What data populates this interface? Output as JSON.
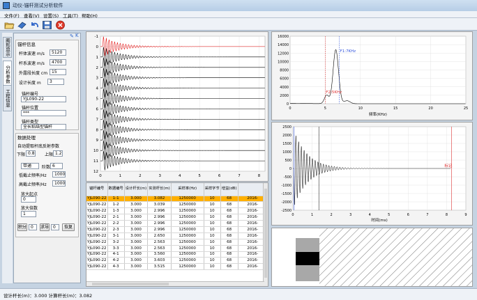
{
  "app": {
    "title": "动仪-锚杆测试分析软件"
  },
  "menu": [
    "文件(F)",
    "查看(V)",
    "设置(S)",
    "工具(T)",
    "帮助(H)"
  ],
  "toolbar": {
    "icons": [
      "open-folder-icon",
      "eraser-icon",
      "undo-icon",
      "save-icon",
      "close-icon"
    ]
  },
  "side_tabs": [
    "图形显示",
    "分析参数",
    "工程信息"
  ],
  "panel": {
    "title": "锚杆信息",
    "fields": [
      {
        "label": "杆体波速 m/s",
        "value": "5120"
      },
      {
        "label": "杆系波速 m/s",
        "value": "4700"
      },
      {
        "label": "外露段长度 cm",
        "value": "15"
      },
      {
        "label": "设计长度 m",
        "value": "3"
      }
    ],
    "id_label": "锚杆编号",
    "id_value": "YJL090-22",
    "pos_label": "锚杆位置",
    "pos_value": "***",
    "type_label": "锚杆类型",
    "type_value": "全长粘结型锚杆"
  },
  "proc": {
    "title": "数据处理",
    "auto_label": "自动提取杆底反射参数",
    "lower_label": "下限",
    "lower_value": "0.8",
    "upper_label": "上限",
    "upper_value": "1.2",
    "filter_value": "带通",
    "order_label": "阶数",
    "order_value": "6",
    "low_cut_label": "低截止频率/Hz",
    "low_cut_value": "1000",
    "high_cut_label": "高截止频率/Hz",
    "high_cut_value": "10000",
    "amp_start_label": "放大起点",
    "amp_start_value": "0",
    "amp_factor_label": "放大倍数",
    "amp_factor_value": "1",
    "integral_label": "积分",
    "integral_value": "0",
    "deriv_label": "求导",
    "deriv_value": "0",
    "restore_label": "恢复"
  },
  "wave": {
    "yticks": [
      "-1",
      "0",
      "1",
      "2",
      "3",
      "4",
      "5",
      "6",
      "7",
      "8",
      "9",
      "10",
      "11",
      "12"
    ],
    "xticks": [
      "0",
      "1",
      "2",
      "3",
      "4",
      "5",
      "6",
      "7",
      "8"
    ],
    "traces": 12
  },
  "table": {
    "headers": [
      "锚杆编号",
      "数据编号",
      "设计杆长(m)",
      "实测杆长(m)",
      "采样率(Hz)",
      "采样字节",
      "增益(dB)",
      ""
    ],
    "rows": [
      [
        "YJL090-22",
        "1-1",
        "3.000",
        "3.082",
        "1250000",
        "10",
        "68",
        "2016-"
      ],
      [
        "YJL090-22",
        "1-2",
        "3.000",
        "3.039",
        "1250000",
        "10",
        "68",
        "2016-"
      ],
      [
        "YJL090-22",
        "1-3",
        "3.000",
        "2.996",
        "1250000",
        "10",
        "68",
        "2016-"
      ],
      [
        "YJL090-22",
        "2-1",
        "3.000",
        "2.996",
        "1250000",
        "10",
        "68",
        "2016-"
      ],
      [
        "YJL090-22",
        "2-2",
        "3.000",
        "2.996",
        "1250000",
        "10",
        "68",
        "2016-"
      ],
      [
        "YJL090-22",
        "2-3",
        "3.000",
        "2.996",
        "1250000",
        "10",
        "68",
        "2016-"
      ],
      [
        "YJL090-22",
        "3-1",
        "3.000",
        "2.650",
        "1250000",
        "10",
        "68",
        "2016-"
      ],
      [
        "YJL090-22",
        "3-2",
        "3.000",
        "2.563",
        "1250000",
        "10",
        "68",
        "2016-"
      ],
      [
        "YJL090-22",
        "3-3",
        "3.000",
        "2.563",
        "1250000",
        "10",
        "68",
        "2016-"
      ],
      [
        "YJL090-22",
        "4-1",
        "3.000",
        "3.560",
        "1250000",
        "10",
        "68",
        "2016-"
      ],
      [
        "YJL090-22",
        "4-2",
        "3.000",
        "3.603",
        "1250000",
        "10",
        "68",
        "2016-"
      ],
      [
        "YJL090-22",
        "4-3",
        "3.000",
        "3.515",
        "1250000",
        "10",
        "68",
        "2016-"
      ]
    ],
    "selected": 0
  },
  "spectrum": {
    "yticks": [
      "0",
      "2000",
      "4000",
      "6000",
      "8000",
      "10000",
      "12000",
      "14000",
      "16000"
    ],
    "xticks": [
      "0",
      "5",
      "10",
      "15",
      "20",
      "25"
    ],
    "xlabel": "频率(KHz)",
    "f1_label": "F1:7KHz",
    "f2_label": "F2:5KHz"
  },
  "time": {
    "yticks": [
      "2500",
      "2000",
      "1500",
      "1000",
      "500",
      "0",
      "-500",
      "-1000",
      "-1500",
      "-2000",
      "-2500"
    ],
    "xticks": [
      "0",
      "1",
      "2",
      "3",
      "4",
      "5",
      "6",
      "7",
      "8",
      "9"
    ],
    "xlabel": "时间(ms)",
    "marker_label": "标记"
  },
  "status": {
    "text": "设计杆长(m)：3.000 计算杆长(m)：3.082"
  },
  "colors": {
    "selected_row": "#ffb000",
    "first_trace": "#e00000",
    "f1_marker": "#3355dd",
    "f2_marker": "#dd3333"
  }
}
